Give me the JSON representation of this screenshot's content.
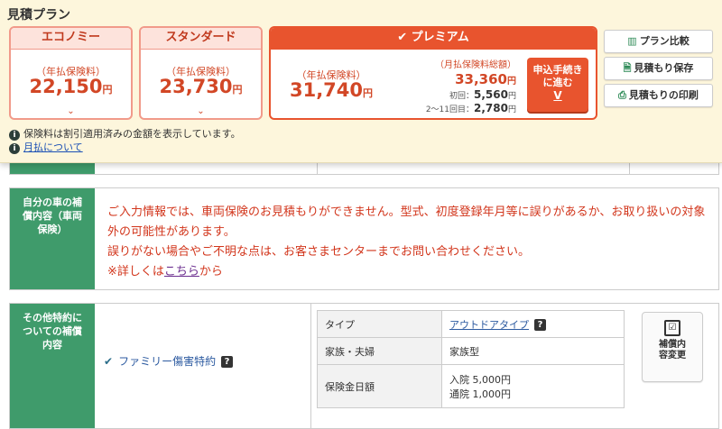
{
  "header": {
    "title": "見積プラン",
    "plans": [
      {
        "name": "エコノミー",
        "annual_label": "（年払保険料）",
        "price": "22,150",
        "yen": "円"
      },
      {
        "name": "スタンダード",
        "annual_label": "（年払保険料）",
        "price": "23,730",
        "yen": "円"
      },
      {
        "name": "プレミアム",
        "annual_label": "（年払保険料）",
        "price": "31,740",
        "yen": "円",
        "monthly_label": "（月払保険料総額）",
        "monthly_total": "33,360",
        "first_label": "初回：",
        "first": "5,560",
        "later_label": "2〜11回目：",
        "later": "2,780"
      }
    ],
    "apply_button": "申込手続きに進む",
    "apply_arrow": "V",
    "side_buttons": [
      "プラン比較",
      "見積もり保存",
      "見積もりの印刷"
    ],
    "notes": [
      "保険料は割引適用済みの金額を表示しています。",
      "月払について"
    ]
  },
  "sections": {
    "car": {
      "label": "自分の車の補償内容（車両保険）",
      "message_line1": "ご入力情報では、車両保険のお見積もりができません。型式、初度登録年月等に誤りがあるか、お取り扱いの対象外の可能性があります。",
      "message_line2": "誤りがない場合やご不明な点は、お客さまセンターまでお問い合わせください。",
      "message_prefix": "※詳しくは",
      "message_link": "こちら",
      "message_suffix": "から"
    },
    "other": {
      "label": "その他特約についての補償内容",
      "rider": "ファミリー傷害特約",
      "table": [
        {
          "key": "タイプ",
          "value": "アウトドアタイプ"
        },
        {
          "key": "家族・夫婦",
          "value": "家族型"
        },
        {
          "key": "保険金日額",
          "value_line1": "入院 5,000円",
          "value_line2": "通院 1,000円"
        }
      ],
      "change_button": "補償内容変更"
    }
  },
  "colors": {
    "accent": "#e8542e",
    "green": "#3f9b6b",
    "bg": "#fdf6dc"
  }
}
